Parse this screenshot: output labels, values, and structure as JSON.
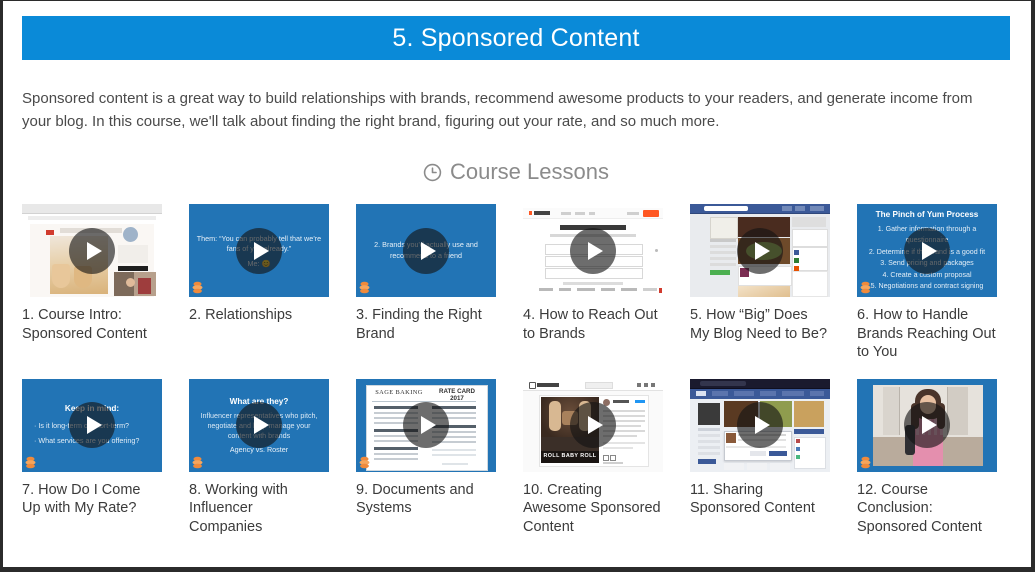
{
  "header": {
    "title": "5. Sponsored Content",
    "bg_color": "#0a8ad8",
    "text_color": "#ffffff"
  },
  "intro": {
    "paragraph": "Sponsored content is a great way to build relationships with brands, recommend awesome products to your readers, and generate income from your blog. In this course, we'll talk about finding the right brand, figuring out your rate, and so much more."
  },
  "lessons_section": {
    "icon": "clock-icon",
    "title": "Course Lessons",
    "title_color": "#8b8b8b"
  },
  "theme": {
    "slide_blue": "#2274b5",
    "caption_color": "#3b3b3b",
    "page_bg": "#ffffff"
  },
  "lessons": [
    {
      "number": "1.",
      "caption": "1. Course Intro: Sponsored Content",
      "thumb_type": "screenshot",
      "thumb_alt": "blog post screenshot with video overlay of man in plaid shirt",
      "play_label": "play-video"
    },
    {
      "number": "2.",
      "caption": "2. Relationships",
      "thumb_type": "slide",
      "slide_quote": "Them: “You can probably tell that we’re fans of you already.”",
      "slide_foot": "Me: 😊",
      "play_label": "play-video"
    },
    {
      "number": "3.",
      "caption": "3. Finding the Right Brand",
      "thumb_type": "slide",
      "slide_quote": "2. Brands you'd actually use and recommend to a friend",
      "play_label": "play-video"
    },
    {
      "number": "4.",
      "caption": "4. How to Reach Out to Brands",
      "thumb_type": "screenshot",
      "thumb_alt": "Hunter.io landing page: Opportunities are one email away",
      "play_label": "play-video"
    },
    {
      "number": "5.",
      "caption": "5. How “Big” Does My Blog Need to Be?",
      "thumb_type": "screenshot",
      "thumb_alt": "Facebook page screenshot for Pinch of Yum",
      "play_label": "play-video"
    },
    {
      "number": "6.",
      "caption": "6. How to Handle Brands Reaching Out to You",
      "thumb_type": "slide",
      "slide_title": "The Pinch of Yum Process",
      "slide_list": [
        "1. Gather information through a questionnaire",
        "2. Determine if the brand is a good fit",
        "3. Send pricing and packages",
        "4. Create a custom proposal",
        "5. Negotiations and contract signing"
      ],
      "play_label": "play-video"
    },
    {
      "number": "7.",
      "caption": "7. How Do I Come Up with My Rate?",
      "thumb_type": "slide",
      "slide_title": "Keep in mind:",
      "slide_bullets": [
        "·  Is it long-term or short-term?",
        "·  What services are you offering?"
      ],
      "play_label": "play-video"
    },
    {
      "number": "8.",
      "caption": "8. Working with Influencer Companies",
      "thumb_type": "slide",
      "slide_title": "What are they?",
      "slide_body": "Influencer representatives who pitch, negotiate and help manage your content with brands",
      "slide_foot": "Agency vs. Roster",
      "play_label": "play-video"
    },
    {
      "number": "9.",
      "caption": "9. Documents and Systems",
      "thumb_type": "document",
      "doc_title": "SAGE BAKING",
      "doc_subtitle": "RATE CARD 2017",
      "play_label": "play-video"
    },
    {
      "number": "10.",
      "caption": "10. Creating Awesome Sponsored Content",
      "thumb_type": "screenshot",
      "thumb_alt": "Instagram post screenshot captioned ROLL BABY ROLL",
      "overlay_text": "ROLL BABY ROLL",
      "play_label": "play-video"
    },
    {
      "number": "11.",
      "caption": "11. Sharing Sponsored Content",
      "thumb_type": "screenshot",
      "thumb_alt": "Facebook food page screenshot with share dialog",
      "play_label": "play-video"
    },
    {
      "number": "12.",
      "caption": "12. Course Conclusion: Sponsored Content",
      "thumb_type": "video",
      "thumb_alt": "woman in pink shirt seated in room talking to camera",
      "play_label": "play-video"
    }
  ]
}
